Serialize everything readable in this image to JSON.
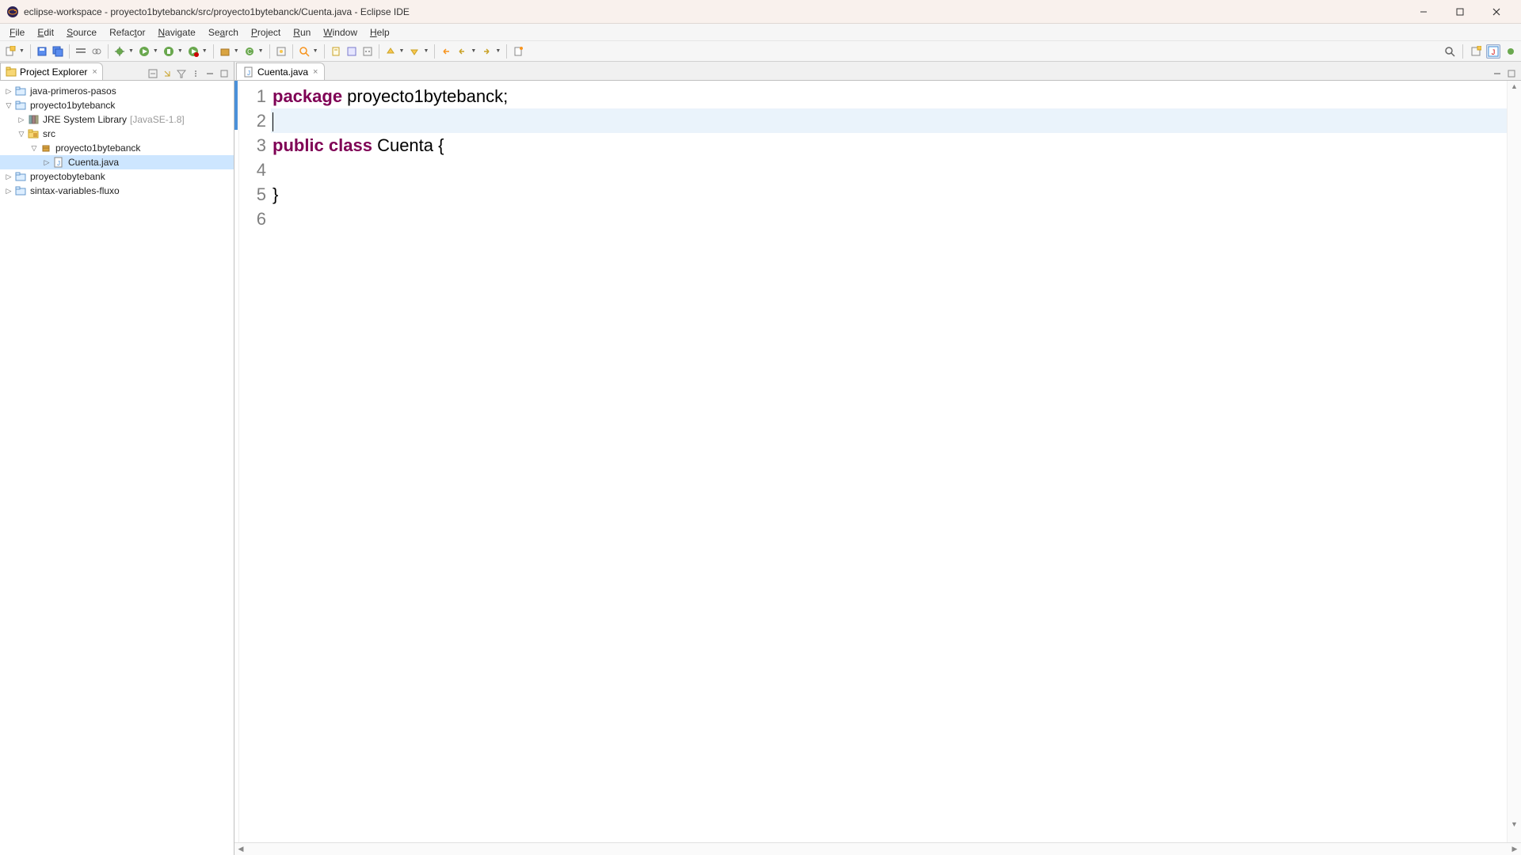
{
  "window": {
    "title": "eclipse-workspace - proyecto1bytebanck/src/proyecto1bytebanck/Cuenta.java - Eclipse IDE"
  },
  "menu": {
    "file": "File",
    "edit": "Edit",
    "source": "Source",
    "refactor": "Refactor",
    "navigate": "Navigate",
    "search": "Search",
    "project": "Project",
    "run": "Run",
    "window": "Window",
    "help": "Help"
  },
  "panels": {
    "explorer": {
      "title": "Project Explorer"
    }
  },
  "tree": {
    "n0": {
      "label": "java-primeros-pasos"
    },
    "n1": {
      "label": "proyecto1bytebanck"
    },
    "n1a": {
      "label": "JRE System Library",
      "qual": "[JavaSE-1.8]"
    },
    "n1b": {
      "label": "src"
    },
    "n1b1": {
      "label": "proyecto1bytebanck"
    },
    "n1b1a": {
      "label": "Cuenta.java"
    },
    "n2": {
      "label": "proyectobytebank"
    },
    "n3": {
      "label": "sintax-variables-fluxo"
    }
  },
  "editor": {
    "tab": {
      "label": "Cuenta.java"
    },
    "lines": {
      "l1": "1",
      "l2": "2",
      "l3": "3",
      "l4": "4",
      "l5": "5",
      "l6": "6"
    },
    "code": {
      "kw_package": "package",
      "pkg_name": " proyecto1bytebanck;",
      "kw_public": "public",
      "kw_class": " class",
      "cls_name": " Cuenta {",
      "close_brace": "}"
    }
  }
}
